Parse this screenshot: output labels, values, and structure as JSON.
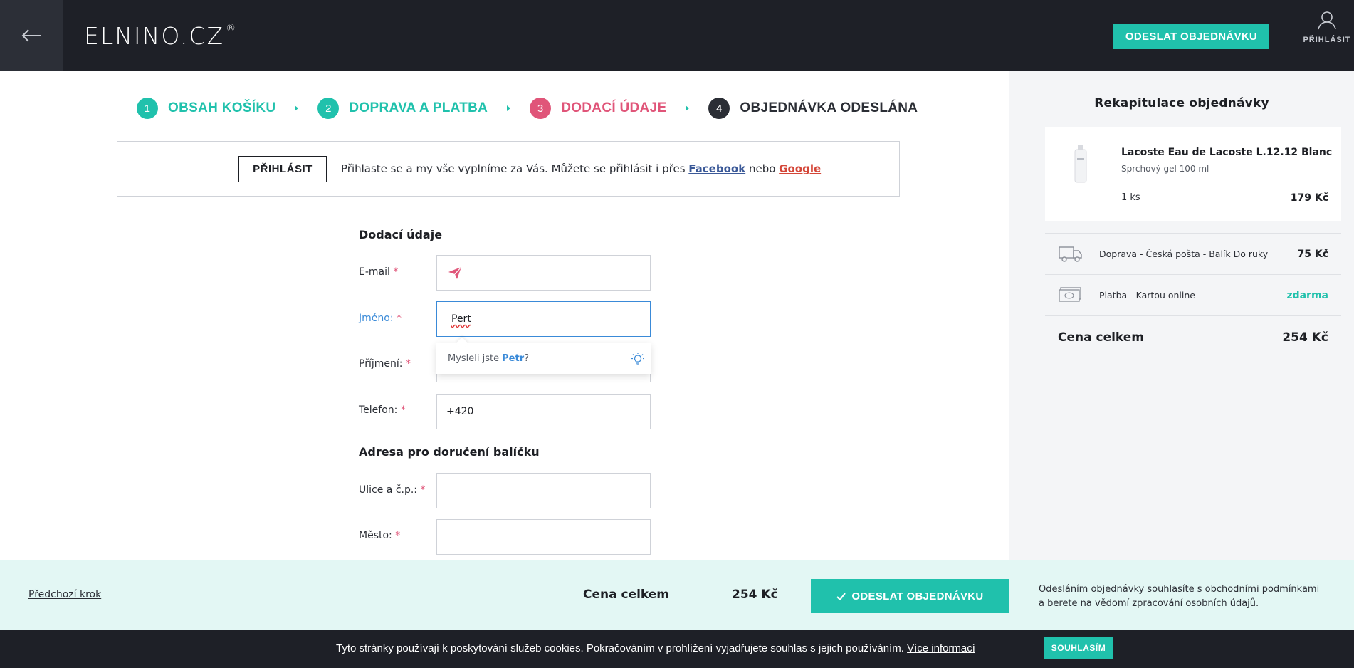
{
  "header": {
    "logo_text": "ELNINO.CZ",
    "logo_mark": "®",
    "cta_label": "ODESLAT OBJEDNÁVKU",
    "user_label": "PŘIHLÁSIT"
  },
  "steps": [
    {
      "num": "1",
      "label": "OBSAH KOŠÍKU",
      "state": "done"
    },
    {
      "num": "2",
      "label": "DOPRAVA A PLATBA",
      "state": "done"
    },
    {
      "num": "3",
      "label": "DODACÍ ÚDAJE",
      "state": "active"
    },
    {
      "num": "4",
      "label": "OBJEDNÁVKA ODESLÁNA",
      "state": "todo"
    }
  ],
  "login_box": {
    "button_label": "PŘIHLÁSIT",
    "text_before": "Přihlaste se a my vše vyplníme za Vás. Můžete se přihlásit i přes ",
    "facebook": "Facebook",
    "text_middle": " nebo ",
    "google": "Google"
  },
  "form": {
    "delivery_title": "Dodací údaje",
    "email_label": "E-mail",
    "email_value": "",
    "name_label": "Jméno:",
    "name_value": "Pert",
    "surname_label": "Příjmení:",
    "surname_value": "",
    "phone_label": "Telefon:",
    "phone_value": "+420",
    "address_title": "Adresa pro doručení balíčku",
    "street_label": "Ulice a č.p.:",
    "street_value": "",
    "city_label": "Město:",
    "city_value": "",
    "required_mark": "*",
    "suggestion_prefix": "Mysleli jste",
    "suggestion_name": "Petr",
    "suggestion_suffix": "?"
  },
  "summary": {
    "title": "Rekapitulace objednávky",
    "product_name": "Lacoste Eau de Lacoste L.12.12 Blanc",
    "product_desc": "Sprchový gel 100 ml",
    "product_qty": "1 ks",
    "product_price": "179 Kč",
    "shipping_label": "Doprava - Česká pošta - Balík Do ruky",
    "shipping_price": "75 Kč",
    "payment_label": "Platba - Kartou online",
    "payment_price": "zdarma",
    "total_label": "Cena celkem",
    "total_price": "254 Kč"
  },
  "footer": {
    "prev_label": "Předchozí krok",
    "total_label": "Cena celkem",
    "total_price": "254 Kč",
    "cta_label": "ODESLAT OBJEDNÁVKU",
    "terms_line1": "Odesláním objednávky souhlasíte s ",
    "terms_link1": "obchodními podmínkami",
    "terms_line2": "a berete na vědomí ",
    "terms_link2": "zpracování osobních údajů",
    "terms_end": "."
  },
  "cookie": {
    "text": "Tyto stránky používají k poskytování služeb cookies. Pokračováním v prohlížení vyjadřujete souhlas s jejich používáním. ",
    "link": "Více informací",
    "button": "SOUHLASÍM"
  },
  "colors": {
    "accent": "#20c1ac",
    "active_step": "#e05579",
    "dark": "#1e2027",
    "focus": "#3a8ad8"
  }
}
